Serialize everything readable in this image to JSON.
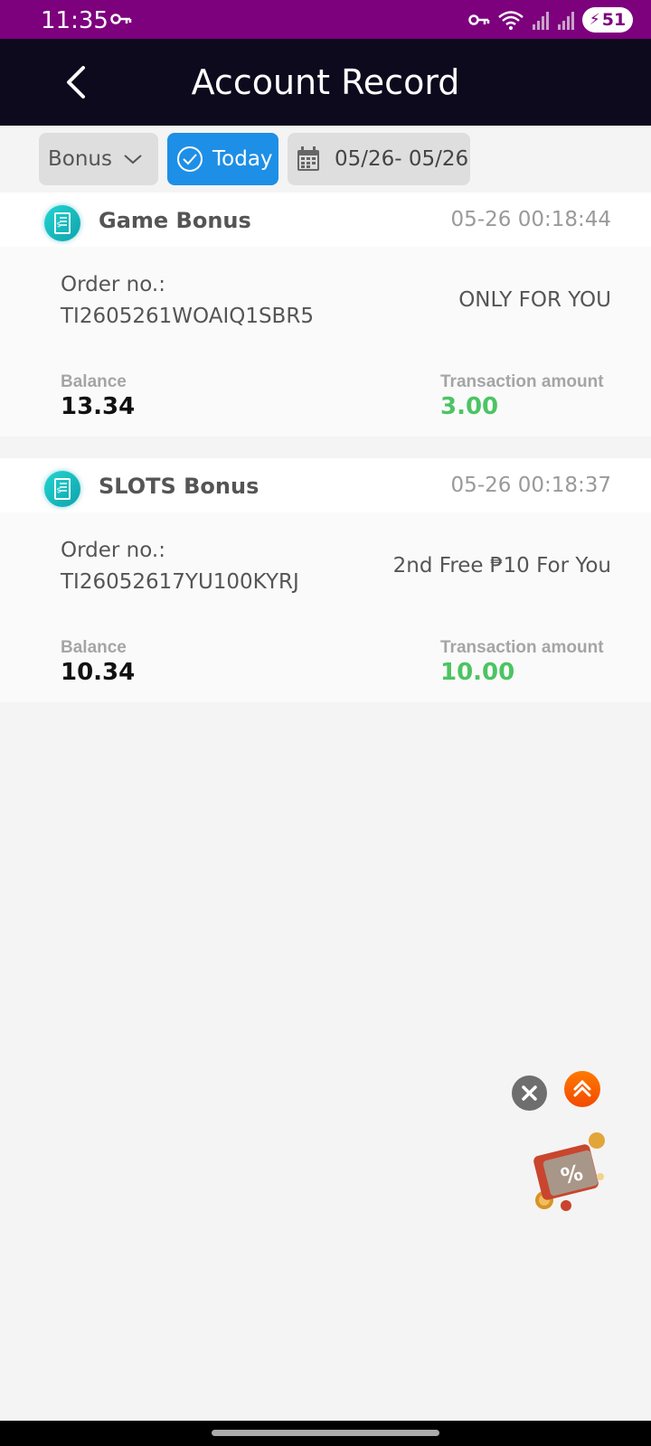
{
  "status_bar": {
    "time": "11:35",
    "battery": "51"
  },
  "header": {
    "title": "Account Record"
  },
  "filters": {
    "type": "Bonus",
    "today": "Today",
    "date_range": "05/26- 05/26"
  },
  "labels": {
    "order_no": "Order no.:",
    "balance": "Balance",
    "transaction_amount": "Transaction amount"
  },
  "records": [
    {
      "title": "Game Bonus",
      "time": "05-26 00:18:44",
      "order_no": "TI2605261WOAIQ1SBR5",
      "remark": "ONLY FOR YOU",
      "balance": "13.34",
      "amount": "3.00"
    },
    {
      "title": "SLOTS Bonus",
      "time": "05-26 00:18:37",
      "order_no": "TI26052617YU100KYRJ",
      "remark": "2nd Free ₱10 For You",
      "balance": "10.34",
      "amount": "10.00"
    }
  ],
  "colors": {
    "status_bar": "#7d007d",
    "header": "#0d0a1e",
    "today_chip": "#1e8fe6",
    "amount": "#4cc463",
    "record_icon": "#14b8c0"
  }
}
